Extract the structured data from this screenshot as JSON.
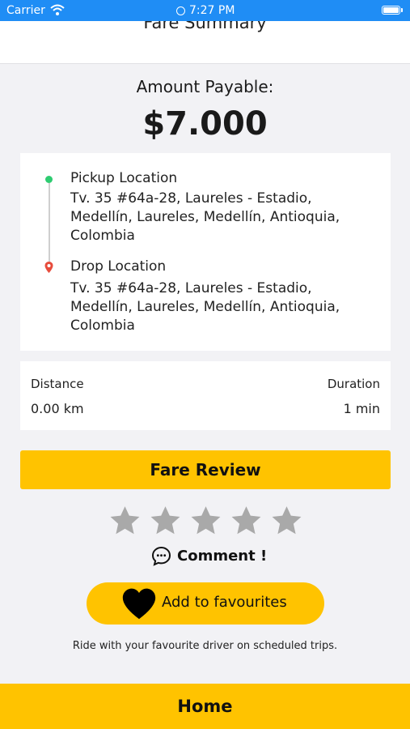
{
  "status_bar": {
    "carrier": "Carrier",
    "time": "7:27 PM"
  },
  "header": {
    "title": "Fare Summary"
  },
  "amount": {
    "label": "Amount Payable:",
    "value": "$7.000"
  },
  "pickup": {
    "title": "Pickup Location",
    "lines": [
      "Tv. 35 #64a-28, Laureles - Estadio,",
      "Medellín, Laureles, Medellín, Antioquia,",
      "Colombia"
    ]
  },
  "drop": {
    "title": "Drop Location",
    "lines": [
      "Tv. 35 #64a-28, Laureles - Estadio,",
      "Medellín, Laureles, Medellín, Antioquia,",
      "Colombia"
    ]
  },
  "stats": {
    "distance_label": "Distance",
    "distance_value": "0.00 km",
    "duration_label": "Duration",
    "duration_value": "1 min"
  },
  "fare_review_label": "Fare Review",
  "rating": {
    "max": 5,
    "selected": 0,
    "star_color": "#a9a9a9"
  },
  "comment_label": "Comment !",
  "favourites": {
    "button_label": "Add to favourites",
    "note": "Ride with your favourite driver on scheduled trips."
  },
  "home_label": "Home",
  "colors": {
    "accent": "#ffc300",
    "status_bar": "#1f8df5",
    "pickup_dot": "#2ecc71",
    "drop_pin": "#e74c3c"
  }
}
